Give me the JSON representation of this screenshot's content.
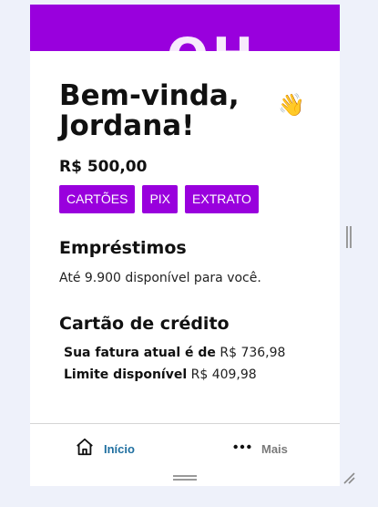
{
  "banner": {
    "text": "OH"
  },
  "greeting": {
    "text": "Bem-vinda, Jordana!",
    "emoji": "👋"
  },
  "balance": {
    "value": "R$ 500,00"
  },
  "actions": [
    {
      "label": "CARTÕES"
    },
    {
      "label": "PIX"
    },
    {
      "label": "EXTRATO"
    }
  ],
  "loans": {
    "title": "Empréstimos",
    "text": "Até 9.900 disponível para você."
  },
  "credit_card": {
    "title": "Cartão de crédito",
    "invoice_label": "Sua fatura atual é de",
    "invoice_value": "R$ 736,98",
    "limit_label": "Limite disponível",
    "limit_value": "R$ 409,98"
  },
  "nav": {
    "home_label": "Início",
    "more_label": "Mais"
  },
  "colors": {
    "brand": "#9900dd",
    "nav_active": "#1f6fa0",
    "nav_inactive": "#7a7a7a"
  },
  "icons": {
    "home": "home-icon",
    "more": "more-dots-icon"
  }
}
